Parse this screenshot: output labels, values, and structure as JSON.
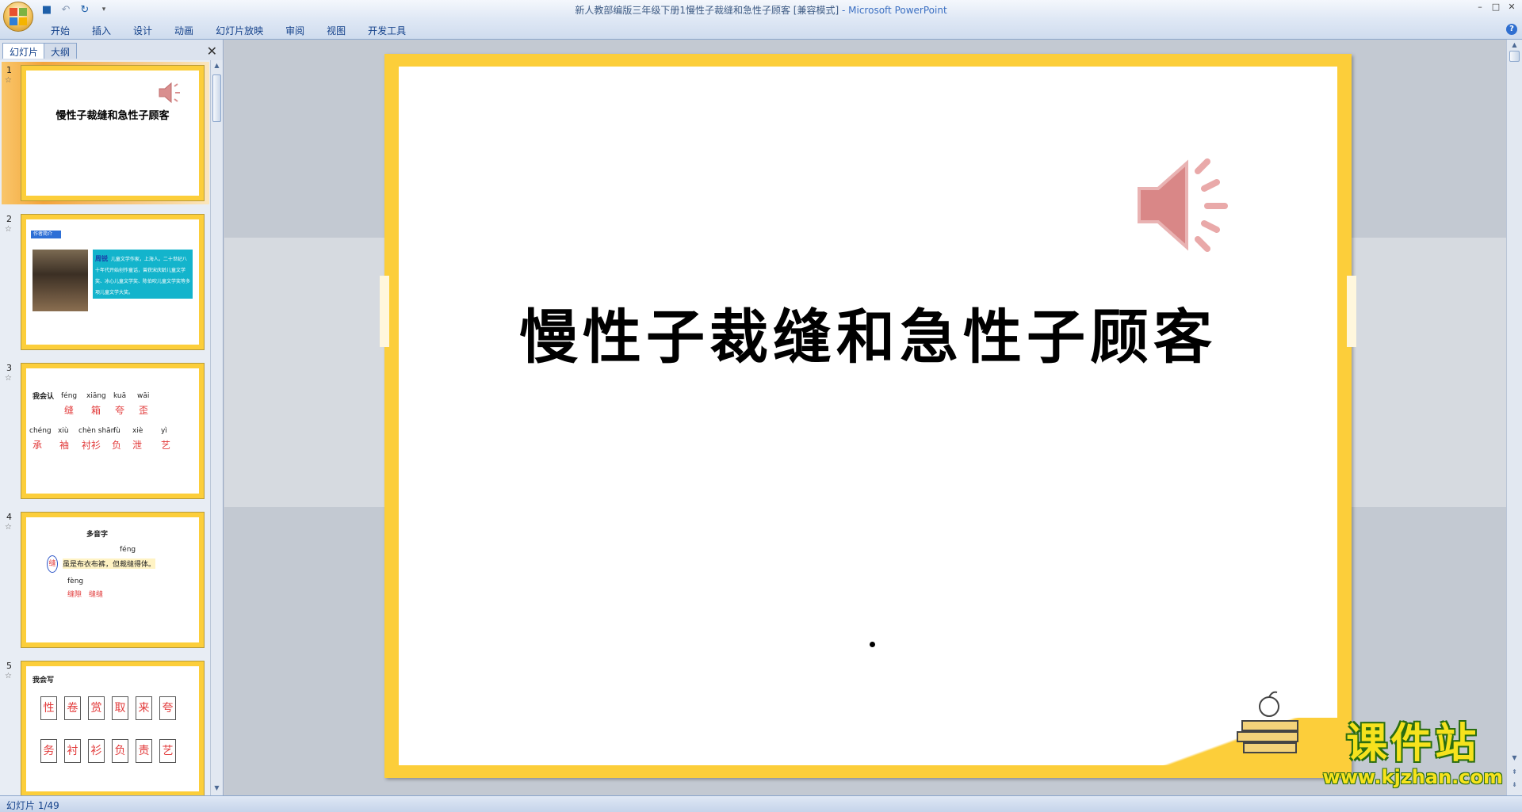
{
  "window": {
    "title": "新人教部编版三年级下册1慢性子裁缝和急性子顾客 [兼容模式]",
    "app_suffix": "- Microsoft PowerPoint",
    "controls": [
      "–",
      "□",
      "✕"
    ]
  },
  "ribbon": {
    "tabs": [
      "开始",
      "插入",
      "设计",
      "动画",
      "幻灯片放映",
      "审阅",
      "视图",
      "开发工具"
    ],
    "help": "?"
  },
  "panel": {
    "tab_slides": "幻灯片",
    "tab_outline": "大纲",
    "close": "✕"
  },
  "thumbnails": [
    {
      "num": "1",
      "title": "慢性子裁缝和急性子顾客"
    },
    {
      "num": "2",
      "heading": "作者简介",
      "name": "周锐",
      "bio": "儿童文学作家，上海人。二十世纪八十年代开始创作童话，曾获宋庆龄儿童文学奖、冰心儿童文学奖、陈伯吹儿童文学奖等多项儿童文学大奖。"
    },
    {
      "num": "3",
      "label": "我会认",
      "row1": [
        {
          "py": "féng",
          "ch": "缝"
        },
        {
          "py": "xiāng",
          "ch": "箱"
        },
        {
          "py": "kuā",
          "ch": "夸"
        },
        {
          "py": "wāi",
          "ch": "歪"
        }
      ],
      "row2": [
        {
          "py": "chéng",
          "ch": "承"
        },
        {
          "py": "xiù",
          "ch": "袖"
        },
        {
          "py": "chèn shān",
          "ch": "衬衫"
        },
        {
          "py": "fù",
          "ch": "负"
        },
        {
          "py": "xiè",
          "ch": "泄"
        },
        {
          "py": "yì",
          "ch": "艺"
        }
      ]
    },
    {
      "num": "4",
      "heading": "多音字",
      "char": "缝",
      "py1": "féng",
      "sentence": "虽是布衣布裤，但裁缝得体。",
      "py2": "fèng",
      "words": "缝隙　缝缝"
    },
    {
      "num": "5",
      "label": "我会写",
      "row1": [
        "性",
        "卷",
        "赏",
        "取",
        "来",
        "夸"
      ],
      "row2": [
        "务",
        "衬",
        "衫",
        "负",
        "责",
        "艺"
      ]
    }
  ],
  "slide": {
    "title": "慢性子裁缝和急性子顾客",
    "frame_color": "#fcce3a"
  },
  "watermark": {
    "big": "课件站",
    "url": "www.kjzhan.com"
  },
  "status": {
    "slide_counter": "幻灯片 1/49"
  }
}
